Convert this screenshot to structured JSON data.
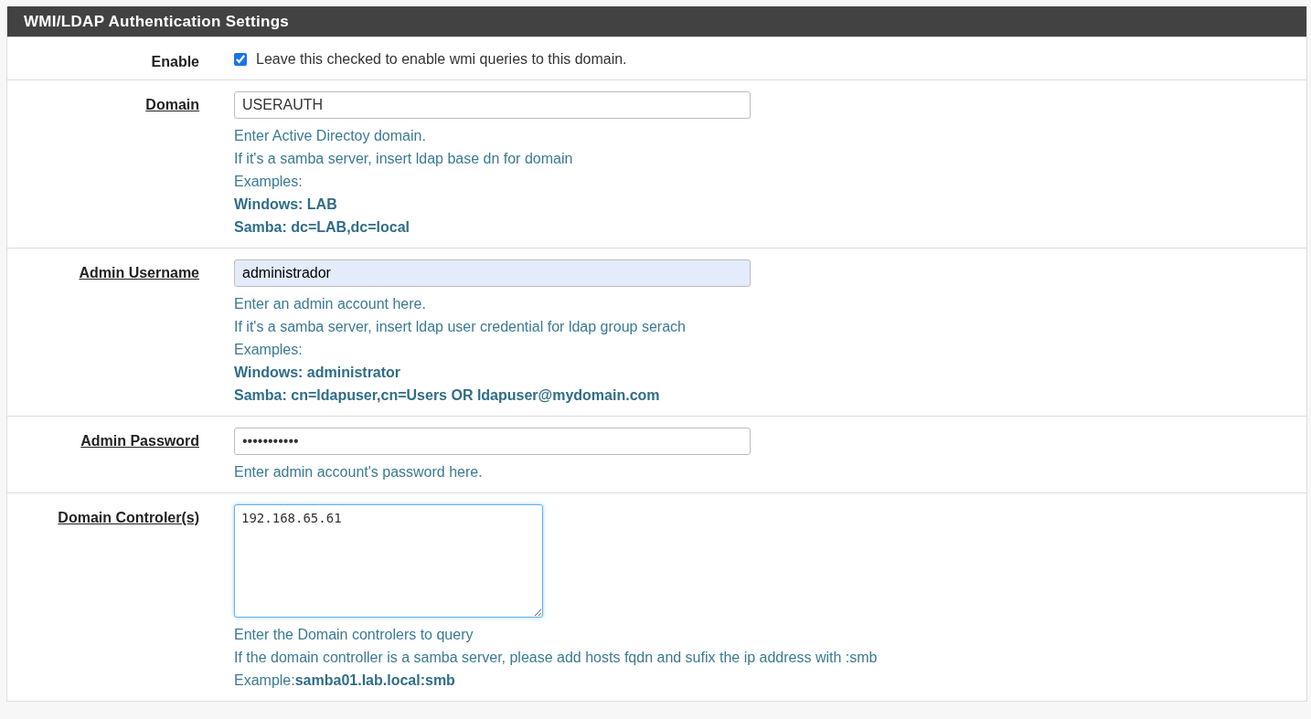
{
  "panel": {
    "title": "WMI/LDAP Authentication Settings"
  },
  "rows": [
    {
      "kind": "checkbox",
      "label": "Enable",
      "required": false,
      "checked": true,
      "caption": "Leave this checked to enable wmi queries to this domain.",
      "help": []
    },
    {
      "kind": "text",
      "label": "Domain",
      "required": true,
      "value": "USERAUTH",
      "autofilled": false,
      "focused": false,
      "help": [
        {
          "text": "Enter Active Directoy domain.",
          "bold": false
        },
        {
          "text": "If it's a samba server, insert ldap base dn for domain",
          "bold": false
        },
        {
          "text": "Examples:",
          "bold": false
        },
        {
          "text": "Windows: LAB",
          "bold": true
        },
        {
          "text": "Samba: dc=LAB,dc=local",
          "bold": true
        }
      ]
    },
    {
      "kind": "text",
      "label": "Admin Username",
      "required": true,
      "value": "administrador",
      "autofilled": true,
      "focused": false,
      "help": [
        {
          "text": "Enter an admin account here.",
          "bold": false
        },
        {
          "text": "If it's a samba server, insert ldap user credential for ldap group serach",
          "bold": false
        },
        {
          "text": "Examples:",
          "bold": false
        },
        {
          "text": "Windows: administrator",
          "bold": true
        },
        {
          "text": "Samba: cn=ldapuser,cn=Users OR ldapuser@mydomain.com",
          "bold": true
        }
      ]
    },
    {
      "kind": "password",
      "label": "Admin Password",
      "required": true,
      "value": "•••••••••••",
      "autofilled": false,
      "focused": false,
      "help": [
        {
          "text": "Enter admin account's password here.",
          "bold": false
        }
      ]
    },
    {
      "kind": "textarea",
      "label": "Domain Controler(s)",
      "required": true,
      "value": "192.168.65.61",
      "focused": true,
      "help": [
        {
          "text": "Enter the Domain controlers to query",
          "bold": false
        },
        {
          "text": "If the domain controller is a samba server, please add hosts fqdn and sufix the ip address with :smb",
          "bold": false
        },
        {
          "text": "Example:**samba01.lab.local:smb**",
          "bold": false
        }
      ]
    }
  ]
}
